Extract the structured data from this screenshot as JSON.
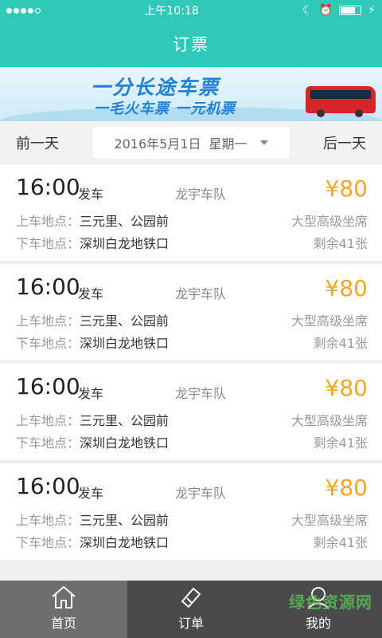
{
  "status_bar": {
    "time": "上午10:18"
  },
  "header": {
    "title": "订票"
  },
  "banner": {
    "line1": "一分长途车票",
    "line2": "一毛火车票 一元机票"
  },
  "date_bar": {
    "prev_label": "前一天",
    "next_label": "后一天",
    "date": "2016年5月1日",
    "weekday": "星期一"
  },
  "tickets": [
    {
      "time": "16:00",
      "depart_label": "发车",
      "company": "龙宇车队",
      "price": "¥80",
      "board_label": "上车地点：",
      "board": "三元里、公园前",
      "alight_label": "下车地点：",
      "alight": "深圳白龙地铁口",
      "seat": "大型高级坐席",
      "remain": "剩余41张"
    },
    {
      "time": "16:00",
      "depart_label": "发车",
      "company": "龙宇车队",
      "price": "¥80",
      "board_label": "上车地点：",
      "board": "三元里、公园前",
      "alight_label": "下车地点：",
      "alight": "深圳白龙地铁口",
      "seat": "大型高级坐席",
      "remain": "剩余41张"
    },
    {
      "time": "16:00",
      "depart_label": "发车",
      "company": "龙宇车队",
      "price": "¥80",
      "board_label": "上车地点：",
      "board": "三元里、公园前",
      "alight_label": "下车地点：",
      "alight": "深圳白龙地铁口",
      "seat": "大型高级坐席",
      "remain": "剩余41张"
    },
    {
      "time": "16:00",
      "depart_label": "发车",
      "company": "龙宇车队",
      "price": "¥80",
      "board_label": "上车地点：",
      "board": "三元里、公园前",
      "alight_label": "下车地点：",
      "alight": "深圳白龙地铁口",
      "seat": "大型高级坐席",
      "remain": "剩余41张"
    }
  ],
  "tabbar": {
    "home": "首页",
    "orders": "订单",
    "mine": "我的"
  },
  "watermark": "绿色资源网",
  "colors": {
    "header": "#2ec9b8",
    "price": "#f5a623",
    "tabbar": "#5b5b5b"
  }
}
